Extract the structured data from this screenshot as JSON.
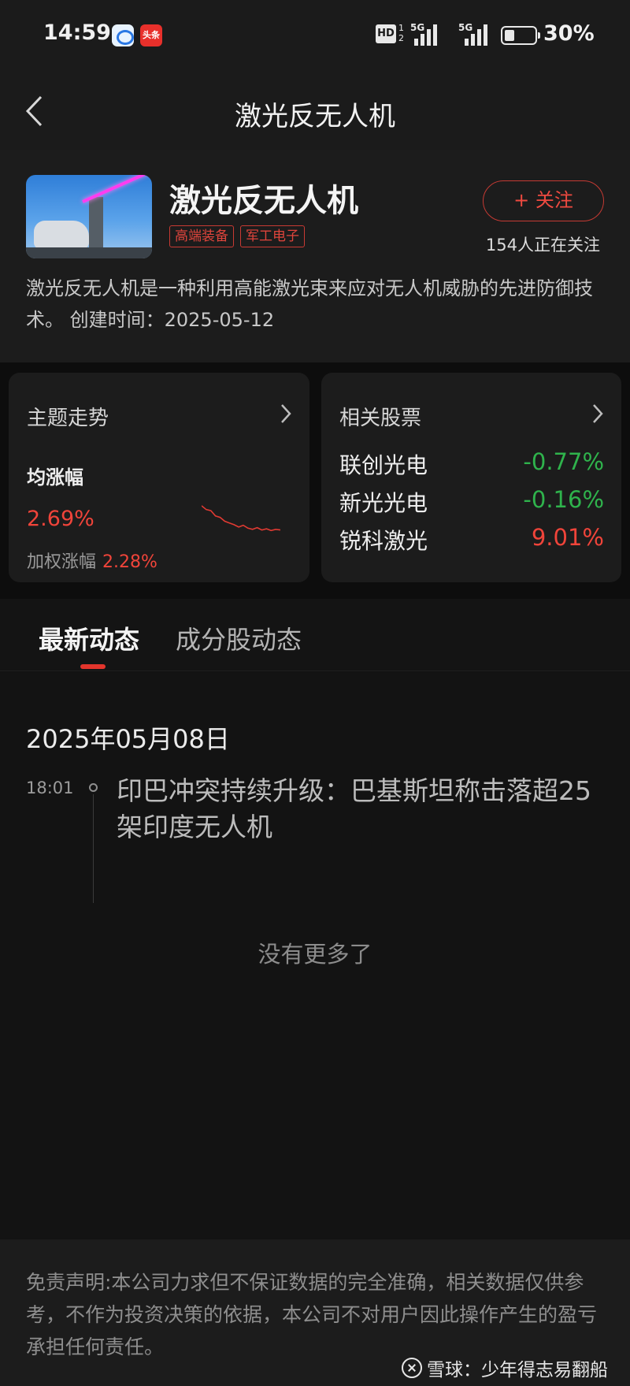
{
  "status_bar": {
    "time": "14:59",
    "app_icon_b_text": "头条",
    "hd": "HD",
    "hd_sub": "1 2",
    "net1": "5G",
    "net2": "5G",
    "battery": "30%"
  },
  "nav": {
    "title": "激光反无人机"
  },
  "topic": {
    "title": "激光反无人机",
    "tags": [
      "高端装备",
      "军工电子"
    ],
    "follow_label": "+ 关注",
    "follow_count": "154人正在关注",
    "description": "激光反无人机是一种利用高能激光束来应对无人机威胁的先进防御技术。 创建时间：2025-05-12"
  },
  "trend_card": {
    "title": "主题走势",
    "avg_label": "均涨幅",
    "avg_value": "2.69%",
    "weighted_label": "加权涨幅",
    "weighted_value": "2.28%",
    "sparkline": [
      0.95,
      0.82,
      0.78,
      0.6,
      0.55,
      0.42,
      0.36,
      0.3,
      0.22,
      0.28,
      0.18,
      0.14,
      0.2,
      0.12,
      0.16,
      0.1,
      0.14,
      0.12
    ],
    "accent_color": "#f0443a"
  },
  "stocks_card": {
    "title": "相关股票",
    "items": [
      {
        "name": "联创光电",
        "change": "-0.77%",
        "direction": "down"
      },
      {
        "name": "新光光电",
        "change": "-0.16%",
        "direction": "down"
      },
      {
        "name": "锐科激光",
        "change": "9.01%",
        "direction": "up"
      }
    ],
    "up_color": "#f0443a",
    "down_color": "#2fb34c"
  },
  "tabs": [
    {
      "label": "最新动态",
      "active": true
    },
    {
      "label": "成分股动态",
      "active": false
    }
  ],
  "feed": {
    "date": "2025年05月08日",
    "items": [
      {
        "time": "18:01",
        "title": "印巴冲突持续升级：巴基斯坦称击落超25架印度无人机"
      }
    ],
    "end_text": "没有更多了"
  },
  "disclaimer": "免责声明:本公司力求但不保证数据的完全准确，相关数据仅供参考，不作为投资决策的依据，本公司不对用户因此操作产生的盈亏承担任何责任。",
  "watermark": "雪球：少年得志易翻船"
}
